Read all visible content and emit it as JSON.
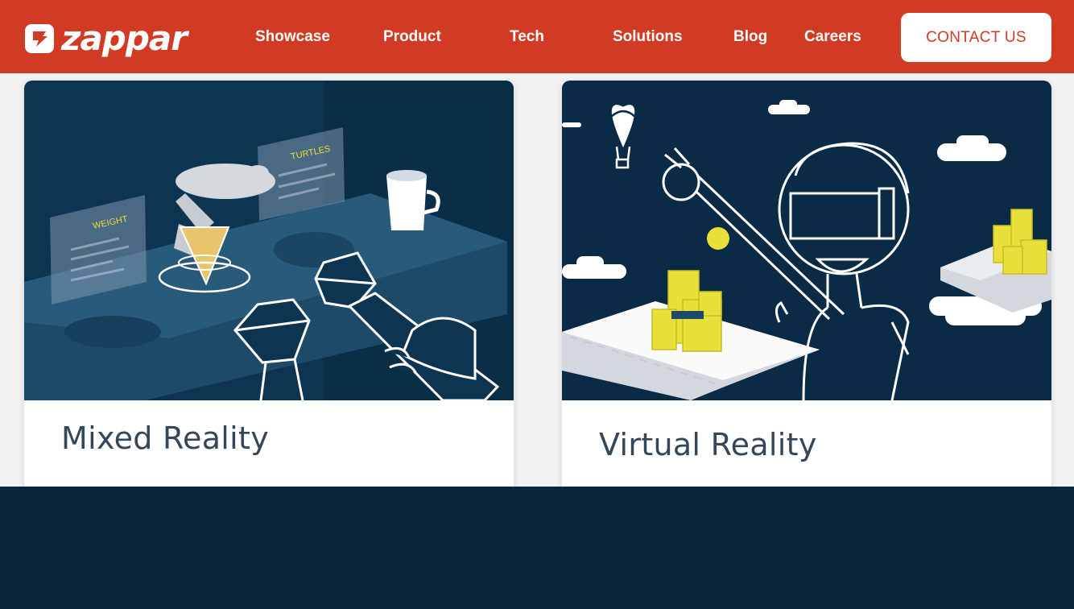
{
  "brand": {
    "name": "zappar",
    "logo_icon": "zappar-logo-icon"
  },
  "nav": {
    "items": [
      {
        "label": "Showcase"
      },
      {
        "label": "Product"
      },
      {
        "label": "Tech"
      },
      {
        "label": "Solutions"
      },
      {
        "label": "Blog"
      },
      {
        "label": "Careers"
      }
    ],
    "cta_label": "CONTACT US"
  },
  "cards": [
    {
      "title": "Mixed Reality",
      "panel_labels": [
        "WEIGHT",
        "TURTLES"
      ]
    },
    {
      "title": "Virtual Reality"
    }
  ],
  "colors": {
    "brand_red": "#d13a23",
    "navy": "#09263d",
    "title_text": "#34465a",
    "accent_yellow": "#e8df3a"
  }
}
